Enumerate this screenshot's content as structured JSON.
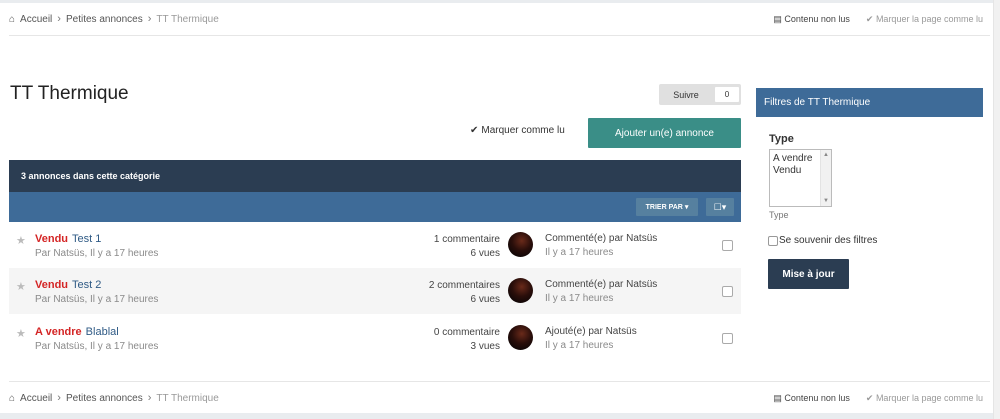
{
  "breadcrumb": {
    "home": "Accueil",
    "level1": "Petites annonces",
    "current": "TT Thermique"
  },
  "crumb_actions": {
    "unread": "Contenu non lus",
    "mark_page": "Marquer la page comme lu"
  },
  "page": {
    "title": "TT Thermique",
    "follow_label": "Suivre",
    "follow_count": "0",
    "mark_read": "Marquer comme lu",
    "add_button": "Ajouter un(e) annonce"
  },
  "list": {
    "header": "3 annonces dans cette catégorie",
    "sort_label": "TRIER PAR",
    "rows": [
      {
        "prefix": "Vendu",
        "title": "Test 1",
        "meta": "Par Natsüs, Il y a 17 heures",
        "comments": "1 commentaire",
        "views": "6 vues",
        "last_action": "Commenté(e) par Natsüs",
        "last_time": "Il y a 17 heures"
      },
      {
        "prefix": "Vendu",
        "title": "Test 2",
        "meta": "Par Natsüs, Il y a 17 heures",
        "comments": "2 commentaires",
        "views": "6 vues",
        "last_action": "Commenté(e) par Natsüs",
        "last_time": "Il y a 17 heures"
      },
      {
        "prefix": "A vendre",
        "title": "Blablal",
        "meta": "Par Natsüs, Il y a 17 heures",
        "comments": "0 commentaire",
        "views": "3 vues",
        "last_action": "Ajouté(e) par Natsüs",
        "last_time": "Il y a 17 heures"
      }
    ]
  },
  "sidebar": {
    "title": "Filtres de TT Thermique",
    "type_label": "Type",
    "options": [
      "A vendre",
      "Vendu"
    ],
    "type_small": "Type",
    "remember": "Se souvenir des filtres",
    "apply": "Mise à jour"
  },
  "colors": {
    "accent_teal": "#3a8e87",
    "header_dark": "#2b3d52",
    "bar_blue": "#3e6b98",
    "prefix_red": "#d42525"
  },
  "icons": [
    "home-icon",
    "check-icon",
    "star-icon",
    "caret-down-icon",
    "checkbox-icon"
  ]
}
